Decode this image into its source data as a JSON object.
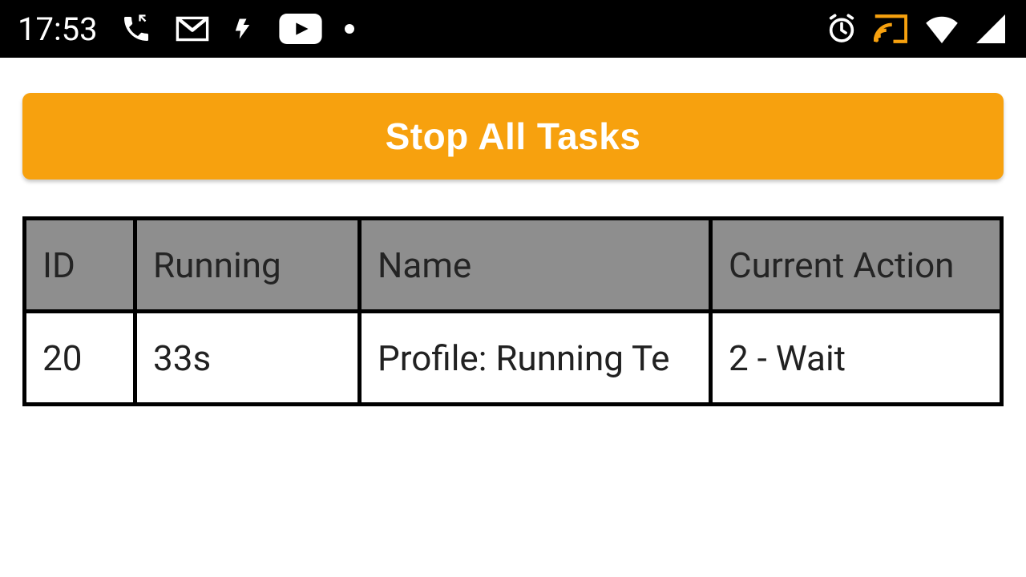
{
  "status_bar": {
    "time": "17:53"
  },
  "main": {
    "stop_button_label": "Stop All Tasks",
    "table": {
      "headers": {
        "id": "ID",
        "running": "Running",
        "name": "Name",
        "action": "Current Action"
      },
      "row": {
        "id": "20",
        "running": "33s",
        "name": "Profile: Running Te",
        "action": "2 - Wait"
      }
    }
  }
}
